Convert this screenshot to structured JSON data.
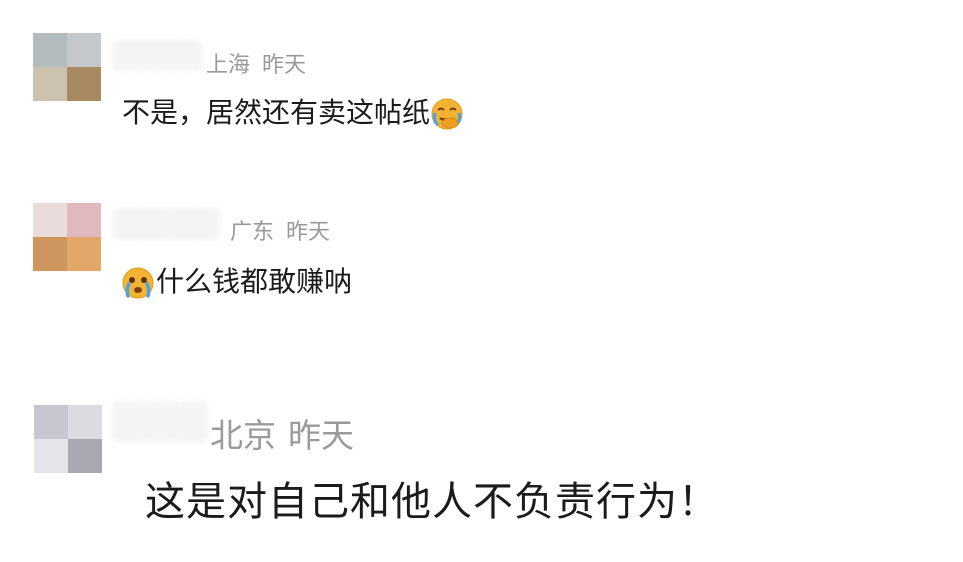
{
  "comments": [
    {
      "location": "上海",
      "time": "昨天",
      "text": "不是，居然还有卖这帖纸",
      "emoji": "face-palm-crying-icon",
      "avatar_colors": [
        "#b4bbbf",
        "#c4c8cb",
        "#cdc1b0",
        "#a88a62"
      ]
    },
    {
      "location": "广东",
      "time": "昨天",
      "text": "什么钱都敢赚呐",
      "emoji": "crying-face-icon",
      "avatar_colors": [
        "#e9dcda",
        "#dfb9bd",
        "#cf955e",
        "#e2a769"
      ]
    },
    {
      "location": "北京",
      "time": "昨天",
      "text": "这是对自己和他人不负责行为！",
      "avatar_colors": [
        "#c8c6d0",
        "#dcdbe2",
        "#e5e4ea",
        "#a9a7b2"
      ]
    }
  ]
}
